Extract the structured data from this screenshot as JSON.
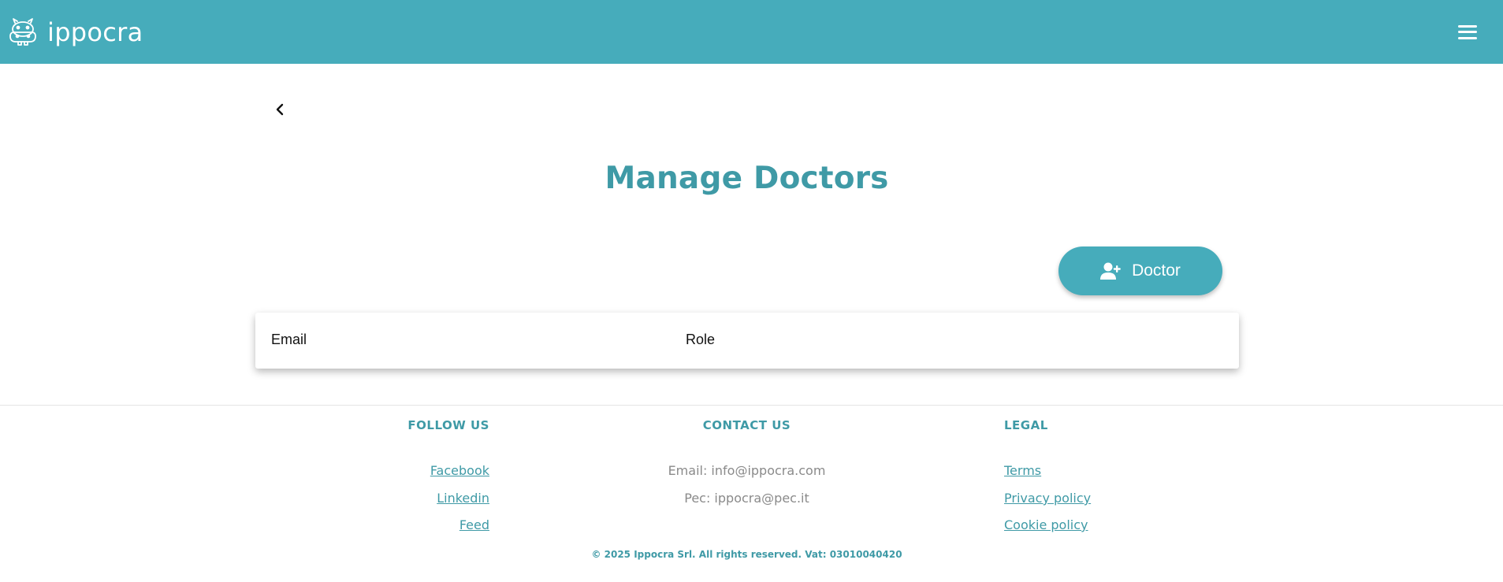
{
  "header": {
    "brand_name": "ippocra",
    "logo_icon": "hippo-icon",
    "menu_icon": "hamburger-menu-icon",
    "background_color": "#46acbb"
  },
  "nav": {
    "back_icon": "chevron-left-icon"
  },
  "main": {
    "title": "Manage Doctors",
    "add_button": {
      "label": "Doctor",
      "icon": "add-user-icon"
    },
    "table": {
      "columns": [
        "Email",
        "Role"
      ]
    }
  },
  "footer": {
    "follow": {
      "heading": "FOLLOW US",
      "links": [
        "Facebook",
        "Linkedin",
        "Feed"
      ]
    },
    "contact": {
      "heading": "CONTACT US",
      "lines": [
        "Email: info@ippocra.com",
        "Pec: ippocra@pec.it"
      ]
    },
    "legal": {
      "heading": "LEGAL",
      "links": [
        "Terms",
        "Privacy policy",
        "Cookie policy"
      ]
    },
    "copyright": "© 2025 Ippocra Srl. All rights reserved. Vat: 03010040420"
  },
  "colors": {
    "accent": "#46acbb",
    "title": "#3f9aa6",
    "muted_text": "#8a8a8a"
  }
}
